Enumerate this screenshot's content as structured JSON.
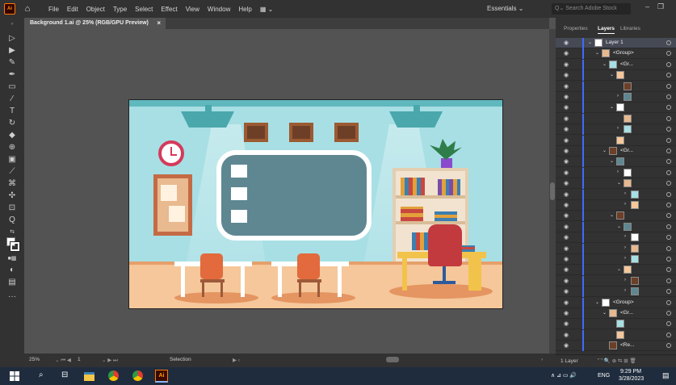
{
  "menubar": {
    "app_logo": "Ai",
    "menus": [
      "File",
      "Edit",
      "Object",
      "Type",
      "Select",
      "Effect",
      "View",
      "Window",
      "Help"
    ],
    "workspace": "Essentials",
    "search_placeholder": "Search Adobe Stock"
  },
  "document_tab": {
    "title": "Background 1.ai @ 25% (RGB/GPU Preview)",
    "close_glyph": "×"
  },
  "statusbar": {
    "zoom": "25%",
    "artboard_index": "1",
    "tool_status": "Selection"
  },
  "panel": {
    "tabs": [
      "Properties",
      "Layers",
      "Libraries"
    ],
    "active_tab": "Layers",
    "layers": [
      {
        "name": "Layer 1",
        "indent": 0,
        "expanded": true,
        "selected": true
      },
      {
        "name": "<Group>",
        "indent": 1,
        "expanded": true
      },
      {
        "name": "<Gr...",
        "indent": 2,
        "expanded": true
      },
      {
        "name": "",
        "indent": 3,
        "expanded": true
      },
      {
        "name": "",
        "indent": 4,
        "expanded": null
      },
      {
        "name": "",
        "indent": 4,
        "expanded": false
      },
      {
        "name": "",
        "indent": 3,
        "expanded": true
      },
      {
        "name": "",
        "indent": 4,
        "expanded": null
      },
      {
        "name": "",
        "indent": 4,
        "expanded": false
      },
      {
        "name": "",
        "indent": 3,
        "expanded": null
      },
      {
        "name": "<Gr...",
        "indent": 2,
        "expanded": true
      },
      {
        "name": "",
        "indent": 3,
        "expanded": true
      },
      {
        "name": "",
        "indent": 4,
        "expanded": false
      },
      {
        "name": "",
        "indent": 4,
        "expanded": true
      },
      {
        "name": "",
        "indent": 5,
        "expanded": false
      },
      {
        "name": "",
        "indent": 5,
        "expanded": false
      },
      {
        "name": "",
        "indent": 3,
        "expanded": true
      },
      {
        "name": "",
        "indent": 4,
        "expanded": true
      },
      {
        "name": "",
        "indent": 5,
        "expanded": false
      },
      {
        "name": "",
        "indent": 5,
        "expanded": false
      },
      {
        "name": "",
        "indent": 5,
        "expanded": false
      },
      {
        "name": "",
        "indent": 4,
        "expanded": true
      },
      {
        "name": "",
        "indent": 5,
        "expanded": false
      },
      {
        "name": "",
        "indent": 5,
        "expanded": false
      },
      {
        "name": "<Group>",
        "indent": 1,
        "expanded": true
      },
      {
        "name": "<Gr...",
        "indent": 2,
        "expanded": true
      },
      {
        "name": "",
        "indent": 3,
        "expanded": null
      },
      {
        "name": "",
        "indent": 3,
        "expanded": null
      },
      {
        "name": "<Re...",
        "indent": 2,
        "expanded": null
      }
    ],
    "footer_label": "1 Layer"
  },
  "taskbar": {
    "language": "ENG",
    "time": "9:29 PM",
    "date": "3/28/2023",
    "ai_label": "Ai"
  },
  "colors": {
    "layer_accent": "#3d6bff",
    "ai_orange": "#ff9a00",
    "artboard_wall": "#a7dfe4"
  }
}
